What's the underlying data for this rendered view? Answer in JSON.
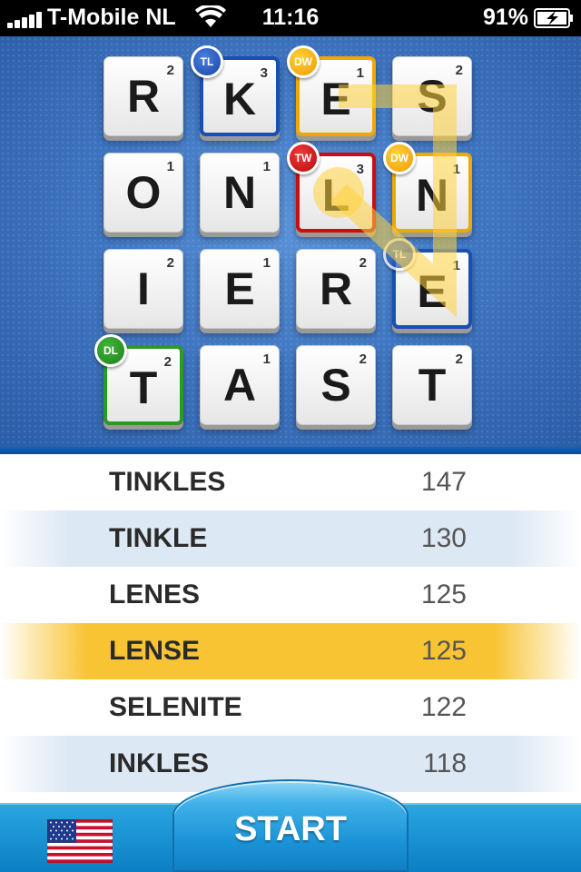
{
  "status_bar": {
    "carrier": "T-Mobile NL",
    "time": "11:16",
    "battery": "91%"
  },
  "board": {
    "rows": [
      [
        {
          "letter": "R",
          "points": "2",
          "bonus": ""
        },
        {
          "letter": "K",
          "points": "3",
          "bonus": "TL"
        },
        {
          "letter": "E",
          "points": "1",
          "bonus": "DW"
        },
        {
          "letter": "S",
          "points": "2",
          "bonus": ""
        }
      ],
      [
        {
          "letter": "O",
          "points": "1",
          "bonus": ""
        },
        {
          "letter": "N",
          "points": "1",
          "bonus": ""
        },
        {
          "letter": "L",
          "points": "3",
          "bonus": "TW"
        },
        {
          "letter": "N",
          "points": "1",
          "bonus": "DW"
        }
      ],
      [
        {
          "letter": "I",
          "points": "2",
          "bonus": ""
        },
        {
          "letter": "E",
          "points": "1",
          "bonus": ""
        },
        {
          "letter": "R",
          "points": "2",
          "bonus": ""
        },
        {
          "letter": "E",
          "points": "1",
          "bonus": "TL"
        }
      ],
      [
        {
          "letter": "T",
          "points": "2",
          "bonus": "DL"
        },
        {
          "letter": "A",
          "points": "1",
          "bonus": ""
        },
        {
          "letter": "S",
          "points": "2",
          "bonus": ""
        },
        {
          "letter": "T",
          "points": "2",
          "bonus": ""
        }
      ]
    ]
  },
  "words": [
    {
      "word": "TINKLES",
      "score": "147"
    },
    {
      "word": "TINKLE",
      "score": "130"
    },
    {
      "word": "LENES",
      "score": "125"
    },
    {
      "word": "LENSE",
      "score": "125"
    },
    {
      "word": "SELENITE",
      "score": "122"
    },
    {
      "word": "INKLES",
      "score": "118"
    }
  ],
  "selected_word_index": 3,
  "bottom_bar": {
    "start_label": "START",
    "flag_icon": "us-flag-icon"
  },
  "colors": {
    "board_blue": "#3f76c2",
    "selected_row": "#f8c434",
    "button_blue": "#1a92d6"
  }
}
